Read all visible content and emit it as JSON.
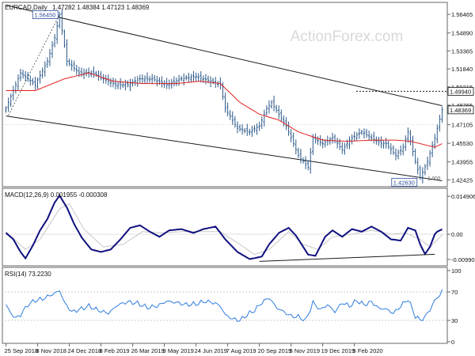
{
  "header": {
    "symbol": "EURCAD,Daily",
    "ohlc": "1.47282 1.48384 1.47123 1.48369"
  },
  "watermark": "ActionForex.com",
  "colors": {
    "background": "#ffffff",
    "price_bars": "#2e5a8a",
    "moving_average": "#e0201e",
    "trendline": "#1a1a1a",
    "macd_line": "#101080",
    "macd_signal": "#c8c8c8",
    "rsi_line": "#2f7de0",
    "panel_border": "#666666",
    "axis_text": "#111111",
    "watermark": "#d8d8d8"
  },
  "chart_data": [
    {
      "type": "candlestick",
      "panel": "price",
      "title": "EURCAD,Daily",
      "y_ticks": [
        "1.56465",
        "1.54890",
        "1.53365",
        "1.51840",
        "1.50315",
        "1.48765",
        "1.47105",
        "1.45530",
        "1.43955",
        "1.42425"
      ],
      "ylim": [
        1.4205,
        1.5715
      ],
      "price_labels": [
        {
          "text": "1.49940",
          "value": 1.4994,
          "style": "boxed"
        },
        {
          "text": "1.48369",
          "value": 1.48369,
          "style": "boxed"
        }
      ],
      "annotations": [
        {
          "text": "1.56450",
          "value": 1.5645,
          "date_index": 22
        },
        {
          "text": "1.42630",
          "value": 1.4263,
          "date_index": 170
        },
        {
          "text": "1.000",
          "value": 1.4263,
          "date_index": 174
        }
      ],
      "horizontal_level": 1.4994,
      "channel": {
        "upper": [
          {
            "i": 0,
            "v": 1.5725
          },
          {
            "i": 179,
            "v": 1.4872
          }
        ],
        "lower": [
          {
            "i": 0,
            "v": 1.4785
          },
          {
            "i": 179,
            "v": 1.4235
          }
        ]
      },
      "series": [
        {
          "name": "price",
          "key_points": [
            [
              0,
              1.485
            ],
            [
              6,
              1.515
            ],
            [
              12,
              1.505
            ],
            [
              17,
              1.525
            ],
            [
              20,
              1.545
            ],
            [
              22,
              1.5645
            ],
            [
              25,
              1.525
            ],
            [
              30,
              1.515
            ],
            [
              36,
              1.515
            ],
            [
              40,
              1.51
            ],
            [
              45,
              1.505
            ],
            [
              50,
              1.505
            ],
            [
              55,
              1.51
            ],
            [
              60,
              1.51
            ],
            [
              66,
              1.505
            ],
            [
              72,
              1.51
            ],
            [
              78,
              1.512
            ],
            [
              84,
              1.508
            ],
            [
              88,
              1.505
            ],
            [
              90,
              1.485
            ],
            [
              95,
              1.468
            ],
            [
              100,
              1.465
            ],
            [
              104,
              1.47
            ],
            [
              107,
              1.485
            ],
            [
              109,
              1.49
            ],
            [
              112,
              1.48
            ],
            [
              115,
              1.47
            ],
            [
              118,
              1.455
            ],
            [
              120,
              1.445
            ],
            [
              124,
              1.435
            ],
            [
              126,
              1.46
            ],
            [
              130,
              1.455
            ],
            [
              134,
              1.46
            ],
            [
              138,
              1.45
            ],
            [
              142,
              1.46
            ],
            [
              146,
              1.465
            ],
            [
              150,
              1.46
            ],
            [
              154,
              1.455
            ],
            [
              156,
              1.455
            ],
            [
              160,
              1.445
            ],
            [
              163,
              1.452
            ],
            [
              165,
              1.465
            ],
            [
              168,
              1.44
            ],
            [
              170,
              1.4263
            ],
            [
              173,
              1.44
            ],
            [
              176,
              1.46
            ],
            [
              179,
              1.48369
            ]
          ]
        },
        {
          "name": "moving average",
          "key_points": [
            [
              0,
              1.5
            ],
            [
              12,
              1.5
            ],
            [
              24,
              1.51
            ],
            [
              34,
              1.515
            ],
            [
              44,
              1.508
            ],
            [
              56,
              1.506
            ],
            [
              70,
              1.506
            ],
            [
              80,
              1.508
            ],
            [
              88,
              1.506
            ],
            [
              96,
              1.49
            ],
            [
              104,
              1.48
            ],
            [
              112,
              1.475
            ],
            [
              120,
              1.465
            ],
            [
              130,
              1.458
            ],
            [
              140,
              1.457
            ],
            [
              150,
              1.458
            ],
            [
              160,
              1.458
            ],
            [
              166,
              1.457
            ],
            [
              172,
              1.454
            ],
            [
              176,
              1.452
            ],
            [
              179,
              1.455
            ]
          ]
        }
      ]
    },
    {
      "type": "line",
      "panel": "macd",
      "title": "MACD(12,26,9) 0.001955 -0.000308",
      "y_ticks": [
        "0.014906",
        "0.00",
        "-0.009906"
      ],
      "ylim": [
        -0.0115,
        0.0162
      ],
      "trendline": [
        {
          "i": 104,
          "v": -0.0107
        },
        {
          "i": 176,
          "v": -0.0079
        }
      ],
      "series": [
        {
          "name": "MACD",
          "key_points": [
            [
              0,
              0.0005
            ],
            [
              3,
              -0.002
            ],
            [
              6,
              -0.007
            ],
            [
              8,
              -0.0095
            ],
            [
              11,
              -0.0045
            ],
            [
              14,
              0.0015
            ],
            [
              17,
              0.006
            ],
            [
              20,
              0.0125
            ],
            [
              22,
              0.0152
            ],
            [
              25,
              0.0105
            ],
            [
              28,
              0.004
            ],
            [
              31,
              -0.0012
            ],
            [
              35,
              -0.006
            ],
            [
              39,
              -0.007
            ],
            [
              43,
              -0.006
            ],
            [
              47,
              -0.002
            ],
            [
              51,
              0.0025
            ],
            [
              55,
              0.0035
            ],
            [
              59,
              0.001
            ],
            [
              63,
              -0.001
            ],
            [
              67,
              0.0015
            ],
            [
              72,
              0.002
            ],
            [
              77,
              0.0005
            ],
            [
              81,
              0.002
            ],
            [
              86,
              0.003
            ],
            [
              90,
              -0.002
            ],
            [
              95,
              -0.007
            ],
            [
              100,
              -0.0098
            ],
            [
              105,
              -0.0088
            ],
            [
              108,
              -0.004
            ],
            [
              112,
              0.0005
            ],
            [
              116,
              0.0025
            ],
            [
              119,
              -0.0005
            ],
            [
              124,
              -0.008
            ],
            [
              127,
              -0.0085
            ],
            [
              131,
              -0.001
            ],
            [
              134,
              0.0015
            ],
            [
              138,
              -0.001
            ],
            [
              142,
              0.002
            ],
            [
              146,
              0.001
            ],
            [
              150,
              0.003
            ],
            [
              154,
              0.001
            ],
            [
              158,
              -0.002
            ],
            [
              162,
              -0.0025
            ],
            [
              165,
              0.0025
            ],
            [
              168,
              0.0015
            ],
            [
              170,
              -0.004
            ],
            [
              172,
              -0.0078
            ],
            [
              174,
              -0.005
            ],
            [
              176,
              0
            ],
            [
              177,
              0.001
            ],
            [
              179,
              0.001955
            ]
          ]
        },
        {
          "name": "Signal",
          "key_points": [
            [
              0,
              0.001
            ],
            [
              8,
              -0.006
            ],
            [
              14,
              -0.002
            ],
            [
              22,
              0.01
            ],
            [
              26,
              0.012
            ],
            [
              32,
              0.002
            ],
            [
              40,
              -0.005
            ],
            [
              48,
              -0.004
            ],
            [
              56,
              0.001
            ],
            [
              64,
              0.0005
            ],
            [
              72,
              0.001
            ],
            [
              80,
              0.001
            ],
            [
              88,
              0.001
            ],
            [
              96,
              -0.004
            ],
            [
              102,
              -0.008
            ],
            [
              108,
              -0.006
            ],
            [
              116,
              0.001
            ],
            [
              122,
              -0.004
            ],
            [
              128,
              -0.006
            ],
            [
              134,
              -0.001
            ],
            [
              142,
              0
            ],
            [
              150,
              0.0015
            ],
            [
              158,
              0
            ],
            [
              164,
              0.0005
            ],
            [
              170,
              -0.002
            ],
            [
              174,
              -0.005
            ],
            [
              179,
              -0.000308
            ]
          ]
        }
      ]
    },
    {
      "type": "line",
      "panel": "rsi",
      "title": "RSI(14) 73.2230",
      "y_ticks": [
        "100",
        "70",
        "30",
        "0"
      ],
      "ylim": [
        0,
        100
      ],
      "levels": [
        70,
        30
      ],
      "series": [
        {
          "name": "RSI",
          "key_points": [
            [
              0,
              52
            ],
            [
              2,
              40
            ],
            [
              4,
              33
            ],
            [
              6,
              38
            ],
            [
              9,
              52
            ],
            [
              12,
              58
            ],
            [
              15,
              60
            ],
            [
              18,
              65
            ],
            [
              20,
              68
            ],
            [
              22,
              72
            ],
            [
              24,
              55
            ],
            [
              27,
              42
            ],
            [
              30,
              45
            ],
            [
              34,
              50
            ],
            [
              38,
              44
            ],
            [
              42,
              40
            ],
            [
              46,
              52
            ],
            [
              50,
              56
            ],
            [
              54,
              54
            ],
            [
              58,
              48
            ],
            [
              62,
              50
            ],
            [
              66,
              57
            ],
            [
              70,
              55
            ],
            [
              74,
              52
            ],
            [
              78,
              53
            ],
            [
              82,
              57
            ],
            [
              86,
              54
            ],
            [
              88,
              50
            ],
            [
              90,
              38
            ],
            [
              93,
              32
            ],
            [
              96,
              30
            ],
            [
              99,
              38
            ],
            [
              102,
              44
            ],
            [
              105,
              55
            ],
            [
              108,
              62
            ],
            [
              111,
              48
            ],
            [
              114,
              42
            ],
            [
              117,
              36
            ],
            [
              120,
              35
            ],
            [
              123,
              30
            ],
            [
              126,
              55
            ],
            [
              129,
              45
            ],
            [
              132,
              52
            ],
            [
              135,
              42
            ],
            [
              138,
              55
            ],
            [
              141,
              50
            ],
            [
              144,
              58
            ],
            [
              147,
              52
            ],
            [
              150,
              56
            ],
            [
              153,
              47
            ],
            [
              156,
              46
            ],
            [
              159,
              40
            ],
            [
              162,
              50
            ],
            [
              165,
              60
            ],
            [
              168,
              36
            ],
            [
              170,
              30
            ],
            [
              172,
              35
            ],
            [
              174,
              45
            ],
            [
              176,
              58
            ],
            [
              178,
              65
            ],
            [
              179,
              73.223
            ]
          ]
        }
      ]
    }
  ],
  "x_axis": {
    "count": 180,
    "labels": [
      {
        "i": 0,
        "text": "25 Sep 2018"
      },
      {
        "i": 13,
        "text": "8 Nov 2018"
      },
      {
        "i": 26,
        "text": "24 Dec 2018"
      },
      {
        "i": 39,
        "text": "8 Feb 2019"
      },
      {
        "i": 52,
        "text": "26 Mar 2019"
      },
      {
        "i": 65,
        "text": "9 May 2019"
      },
      {
        "i": 78,
        "text": "24 Jun 2019"
      },
      {
        "i": 91,
        "text": "7 Aug 2019"
      },
      {
        "i": 104,
        "text": "20 Sep 2019"
      },
      {
        "i": 117,
        "text": "5 Nov 2019"
      },
      {
        "i": 130,
        "text": "19 Dec 2019"
      },
      {
        "i": 143,
        "text": "5 Feb 2020"
      }
    ]
  }
}
